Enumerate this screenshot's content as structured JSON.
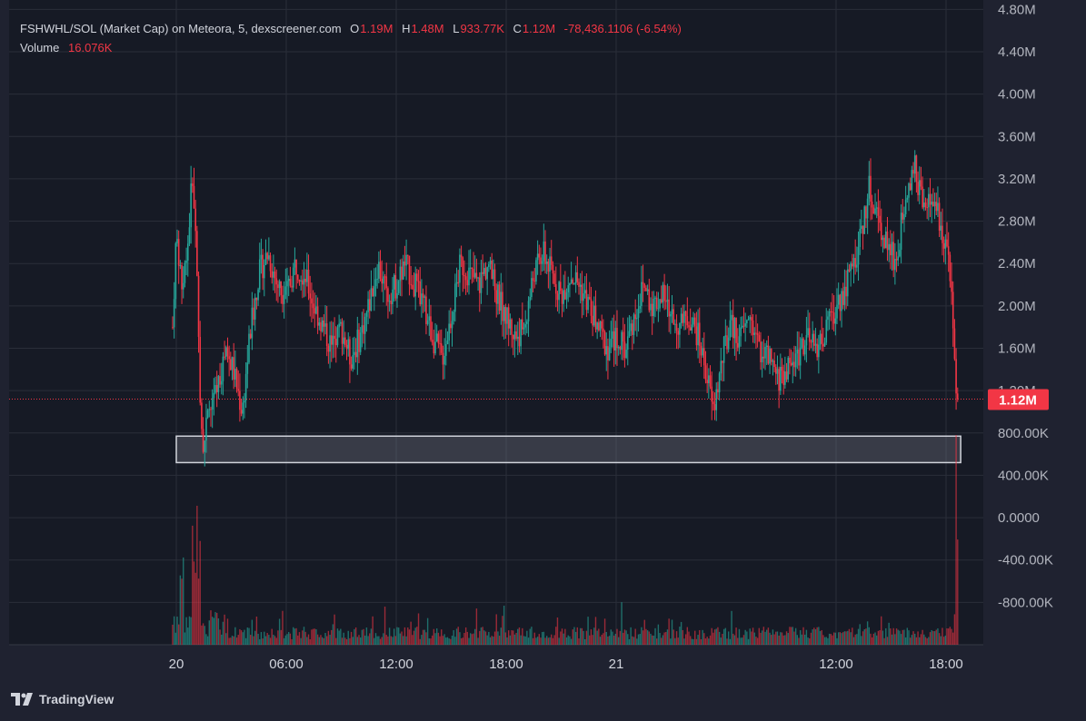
{
  "legend": {
    "title": "FSHWHL/SOL (Market Cap) on Meteora, 5, dexscreener.com",
    "o_key": "O",
    "o_val": "1.19M",
    "h_key": "H",
    "h_val": "1.48M",
    "l_key": "L",
    "l_val": "933.77K",
    "c_key": "C",
    "c_val": "1.12M",
    "change": "-78,436.1106 (-6.54%)",
    "volume_key": "Volume",
    "volume_val": "16.076K"
  },
  "price_badge": "1.12M",
  "brand": "TradingView",
  "colors": {
    "up": "#26a69a",
    "down": "#f23645",
    "bg": "#161a25",
    "grid": "#2a2e39",
    "badge": "#f23645"
  },
  "chart_data": {
    "type": "candlestick",
    "y_tick_labels": [
      "4.80M",
      "4.40M",
      "4.00M",
      "3.60M",
      "3.20M",
      "2.80M",
      "2.40M",
      "2.00M",
      "1.60M",
      "1.20M",
      "800.00K",
      "400.00K",
      "0.0000",
      "-400.00K",
      "-800.00K"
    ],
    "y_tick_values": [
      4800000,
      4400000,
      4000000,
      3600000,
      3200000,
      2800000,
      2400000,
      2000000,
      1600000,
      1200000,
      800000,
      400000,
      0,
      -400000,
      -800000
    ],
    "ylim": [
      -1200000,
      4820000
    ],
    "x_tick_labels": [
      "20",
      "06:00",
      "12:00",
      "18:00",
      "21",
      "12:00",
      "18:00"
    ],
    "x_tick_hours": [
      24,
      30,
      36,
      42,
      48,
      60,
      66
    ],
    "xlim": [
      24.5,
      68.5
    ],
    "last_close": 1120000,
    "zone": {
      "low": 520000,
      "high": 770000,
      "hour_start": 19.3,
      "hour_end": 62.1
    },
    "price_anchors": [
      [
        19.1,
        1800000
      ],
      [
        19.3,
        2700000
      ],
      [
        19.6,
        2200000
      ],
      [
        19.9,
        2500000
      ],
      [
        20.2,
        3300000
      ],
      [
        20.45,
        2100000
      ],
      [
        20.6,
        1000000
      ],
      [
        20.8,
        700000
      ],
      [
        21.1,
        1000000
      ],
      [
        21.5,
        1200000
      ],
      [
        22.0,
        1600000
      ],
      [
        22.4,
        1400000
      ],
      [
        22.9,
        1000000
      ],
      [
        23.3,
        1700000
      ],
      [
        23.8,
        2300000
      ],
      [
        24.3,
        2500000
      ],
      [
        24.8,
        2200000
      ],
      [
        25.3,
        2100000
      ],
      [
        25.8,
        2400000
      ],
      [
        26.3,
        2300000
      ],
      [
        26.8,
        2000000
      ],
      [
        27.3,
        1800000
      ],
      [
        27.8,
        1600000
      ],
      [
        28.3,
        1800000
      ],
      [
        28.8,
        1500000
      ],
      [
        29.3,
        1700000
      ],
      [
        29.8,
        2000000
      ],
      [
        30.3,
        2400000
      ],
      [
        30.8,
        2100000
      ],
      [
        31.3,
        2200000
      ],
      [
        31.8,
        2400000
      ],
      [
        32.3,
        2200000
      ],
      [
        32.8,
        2000000
      ],
      [
        33.3,
        1700000
      ],
      [
        33.8,
        1500000
      ],
      [
        34.3,
        1900000
      ],
      [
        34.8,
        2400000
      ],
      [
        35.3,
        2300000
      ],
      [
        35.8,
        2200000
      ],
      [
        36.3,
        2400000
      ],
      [
        36.8,
        2100000
      ],
      [
        37.3,
        1900000
      ],
      [
        37.8,
        1700000
      ],
      [
        38.3,
        1800000
      ],
      [
        38.8,
        2300000
      ],
      [
        39.3,
        2500000
      ],
      [
        39.8,
        2300000
      ],
      [
        40.3,
        2100000
      ],
      [
        40.8,
        2300000
      ],
      [
        41.3,
        2200000
      ],
      [
        41.8,
        2000000
      ],
      [
        42.3,
        1800000
      ],
      [
        42.8,
        1600000
      ],
      [
        43.3,
        1700000
      ],
      [
        43.8,
        1600000
      ],
      [
        44.3,
        1900000
      ],
      [
        44.8,
        2200000
      ],
      [
        45.3,
        2000000
      ],
      [
        45.8,
        2100000
      ],
      [
        46.3,
        1900000
      ],
      [
        46.8,
        1800000
      ],
      [
        47.3,
        1900000
      ],
      [
        47.8,
        1700000
      ],
      [
        48.3,
        1300000
      ],
      [
        48.6,
        1000000
      ],
      [
        48.8,
        1200000
      ],
      [
        49.2,
        1600000
      ],
      [
        49.6,
        1800000
      ],
      [
        50.1,
        1700000
      ],
      [
        50.6,
        1900000
      ],
      [
        51.1,
        1600000
      ],
      [
        51.6,
        1500000
      ],
      [
        52.1,
        1300000
      ],
      [
        52.6,
        1400000
      ],
      [
        53.1,
        1500000
      ],
      [
        53.6,
        1700000
      ],
      [
        54.1,
        1600000
      ],
      [
        54.6,
        1700000
      ],
      [
        55.1,
        1900000
      ],
      [
        55.6,
        2100000
      ],
      [
        56.1,
        2300000
      ],
      [
        56.6,
        2600000
      ],
      [
        57.1,
        3100000
      ],
      [
        57.6,
        2800000
      ],
      [
        58.1,
        2600000
      ],
      [
        58.6,
        2400000
      ],
      [
        59.1,
        3100000
      ],
      [
        59.6,
        3300000
      ],
      [
        60.1,
        2900000
      ],
      [
        60.6,
        3000000
      ],
      [
        61.1,
        2700000
      ],
      [
        61.5,
        2400000
      ],
      [
        61.8,
        1300000
      ],
      [
        62.0,
        1120000
      ]
    ],
    "volume_spikes": [
      [
        20.5,
        600000
      ],
      [
        61.9,
        900000
      ],
      [
        62.1,
        750000
      ],
      [
        20.3,
        500000
      ],
      [
        19.6,
        450000
      ]
    ]
  }
}
